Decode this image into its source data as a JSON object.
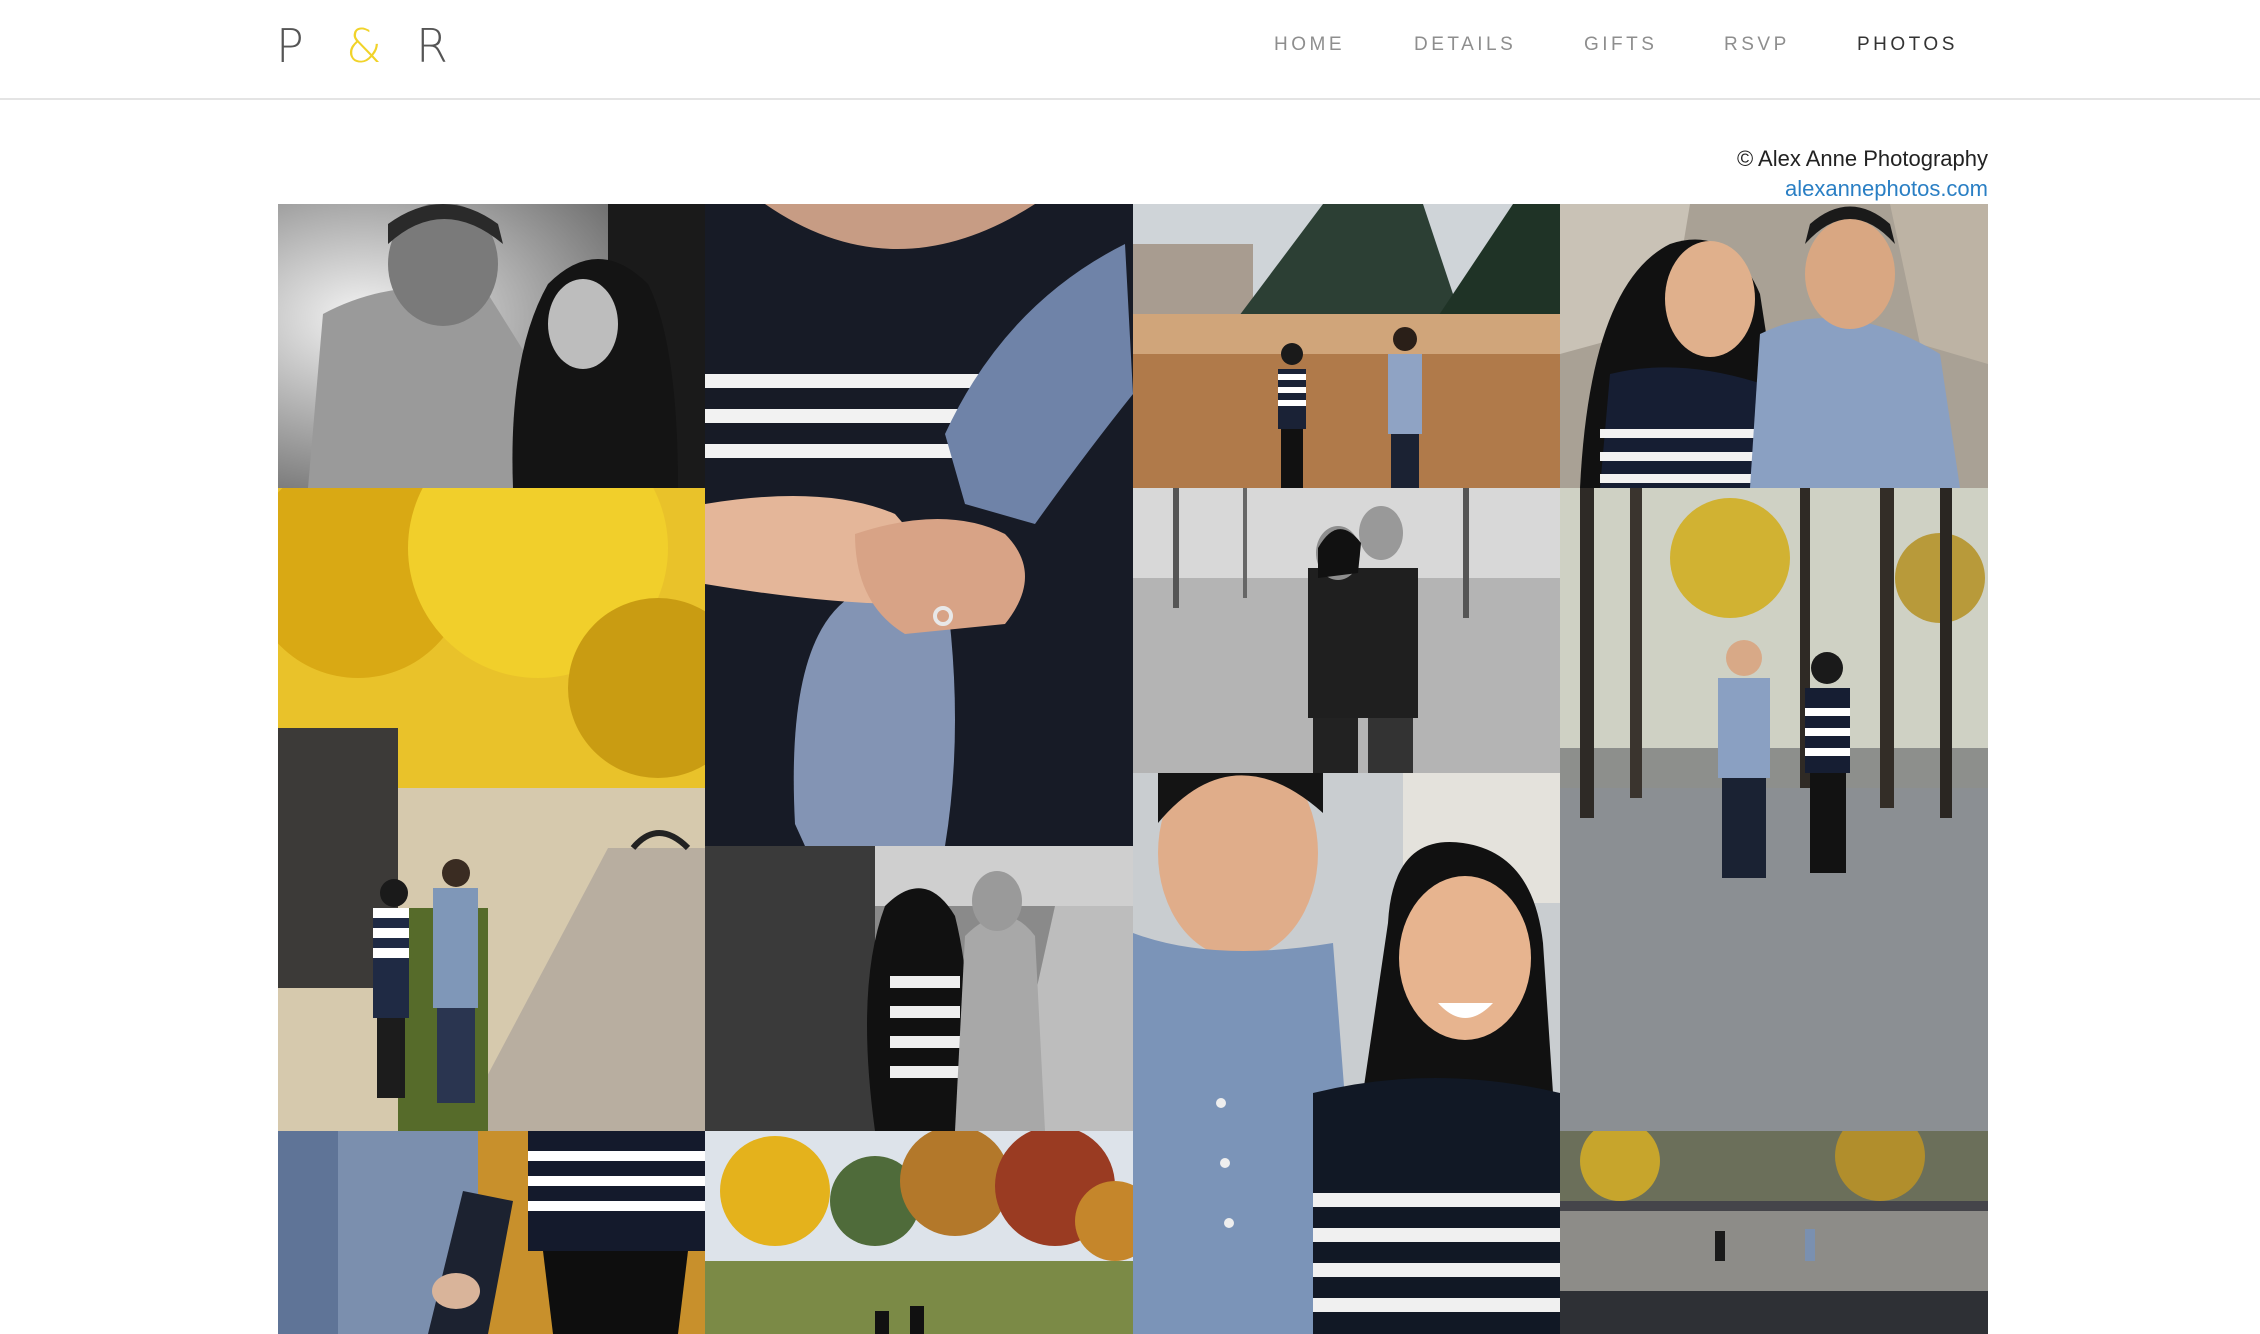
{
  "logo": {
    "first": "P",
    "amp": "&",
    "second": "R"
  },
  "nav": {
    "items": [
      {
        "label": "HOME",
        "active": false
      },
      {
        "label": "DETAILS",
        "active": false
      },
      {
        "label": "GIFTS",
        "active": false
      },
      {
        "label": "RSVP",
        "active": false
      },
      {
        "label": "PHOTOS",
        "active": true
      }
    ]
  },
  "credit": {
    "byline": "© Alex Anne Photography",
    "link": "alexannephotos.com"
  },
  "gallery": {
    "photos": [
      {
        "name": "photo-couple-bw-closeup",
        "scene": "bw-couple"
      },
      {
        "name": "photo-holding-hands-ring",
        "scene": "hands-ring"
      },
      {
        "name": "photo-couple-tall-grass",
        "scene": "grass-field"
      },
      {
        "name": "photo-couple-laughing-rocks",
        "scene": "rocks-couple"
      },
      {
        "name": "photo-couple-yellow-tree-walk",
        "scene": "yellow-trees"
      },
      {
        "name": "photo-couple-bw-hug",
        "scene": "bw-hug"
      },
      {
        "name": "photo-couple-tree-lane",
        "scene": "tree-lane"
      },
      {
        "name": "photo-couple-bw-walkway",
        "scene": "bw-walkway"
      },
      {
        "name": "photo-couple-laughing-closeup",
        "scene": "laughing"
      },
      {
        "name": "photo-holding-hands-leaves",
        "scene": "hands-leaves"
      },
      {
        "name": "photo-autumn-park-running",
        "scene": "autumn-park"
      },
      {
        "name": "photo-couple-plaza-distance",
        "scene": "plaza"
      }
    ]
  }
}
